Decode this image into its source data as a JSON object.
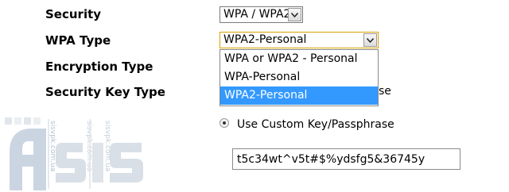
{
  "form": {
    "security_label": "Security",
    "wpa_type_label": "WPA Type",
    "encryption_type_label": "Encryption Type",
    "security_key_type_label": "Security Key Type",
    "security_value": "WPA / WPA2",
    "wpa_type_value": "WPA2-Personal",
    "wpa_type_options": [
      "WPA or WPA2 - Personal",
      "WPA-Personal",
      "WPA2-Personal"
    ],
    "wpa_type_selected_index": 2,
    "partially_hidden_text": "se",
    "custom_key_radio_label": "Use Custom Key/Passphrase",
    "custom_key_value": "t5c34wt^v5t#$%ydsfg5&36745y"
  },
  "watermark": {
    "logo_text": "ASIS",
    "vertical_text": "sisvpk.com.ua"
  },
  "colors": {
    "selection": "#3399ff",
    "focus_border": "#d9a000"
  }
}
